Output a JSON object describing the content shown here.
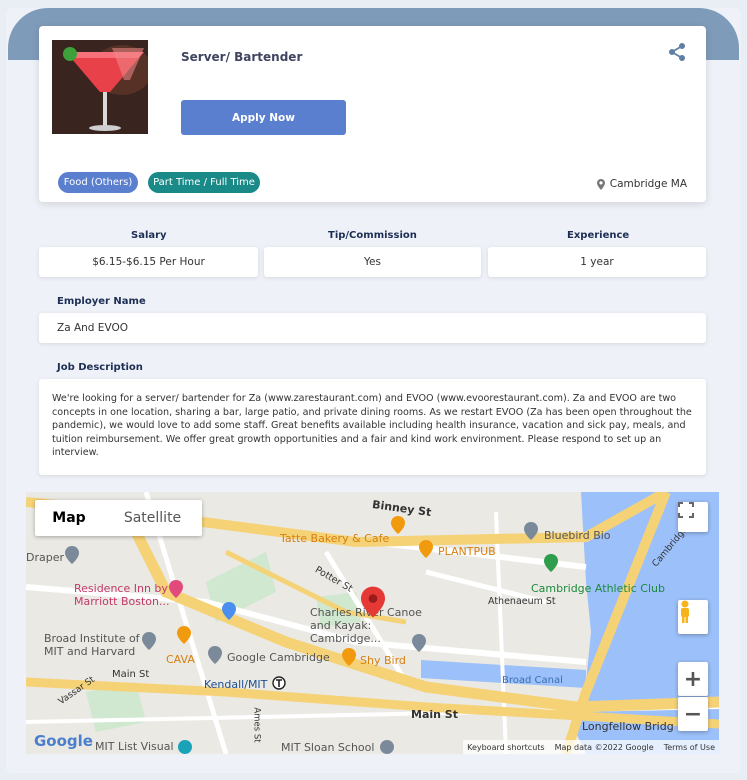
{
  "job": {
    "title": "Server/ Bartender",
    "apply_label": "Apply Now",
    "tags": [
      "Food (Others)",
      "Part Time / Full Time"
    ],
    "location": "Cambridge MA"
  },
  "details": {
    "salary_label": "Salary",
    "salary_value": "$6.15-$6.15 Per Hour",
    "tip_label": "Tip/Commission",
    "tip_value": "Yes",
    "experience_label": "Experience",
    "experience_value": "1 year",
    "employer_label": "Employer Name",
    "employer_value": "Za And EVOO",
    "description_label": "Job Description",
    "description": "We're looking for a server/ bartender for Za (www.zarestaurant.com) and EVOO (www.evoorestaurant.com). Za and EVOO are two concepts in one location, sharing a bar, large patio, and private dining rooms. As we restart EVOO (Za has been open throughout the pandemic), we would love to add some staff. Great benefits available including health insurance, vacation and sick pay, meals, and tuition reimbursement. We offer great growth opportunities and a fair and kind work environment. Please respond to set up an interview."
  },
  "map": {
    "tab_map": "Map",
    "tab_satellite": "Satellite",
    "labels": {
      "binney": "Binney St",
      "tatte": "Tatte Bakery & Cafe",
      "plantpub": "PLANTPUB",
      "bluebird": "Bluebird Bio",
      "cambridge_pkwy": "Cambridge Pkwy",
      "draper": "Draper",
      "residence_inn": "Residence Inn by Marriott Boston...",
      "athletic": "Cambridge Athletic Club",
      "potter": "Potter St",
      "athenaeum": "Athenaeum St",
      "charles_river": "Charles River Canoe and Kayak: Cambridge...",
      "broad": "Broad Institute of MIT and Harvard",
      "cava": "CAVA",
      "google_cambridge": "Google Cambridge",
      "shy_bird": "Shy Bird",
      "main_st_1": "Main St",
      "main_st_2": "Main St",
      "kendall": "Kendall/MIT",
      "vassar": "Vassar St",
      "broad_canal": "Broad Canal",
      "longfellow": "Longfellow Bridg",
      "mit_list": "MIT List Visual",
      "mit_sloan": "MIT Sloan School",
      "ames": "Ames St"
    },
    "footer": {
      "shortcuts": "Keyboard shortcuts",
      "data": "Map data ©2022 Google",
      "terms": "Terms of Use"
    },
    "logo": "Google"
  },
  "colors": {
    "primary": "#5b7fcf",
    "teal": "#1a8a88",
    "heading": "#1d2e54",
    "band": "#7f9bba"
  }
}
